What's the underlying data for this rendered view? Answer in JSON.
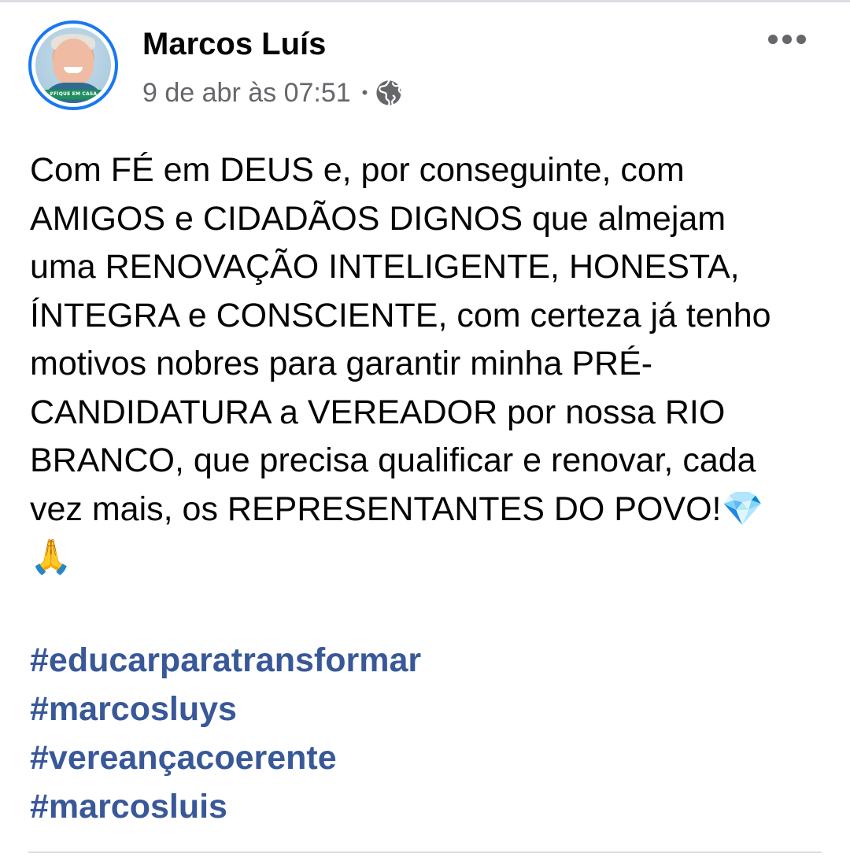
{
  "post": {
    "author": {
      "name": "Marcos Luís",
      "avatar_banner_text": "#FIQUE EM CASA"
    },
    "meta": {
      "timestamp": "9 de abr às 07:51",
      "separator": "•",
      "privacy_icon": "globe-icon"
    },
    "more_icon": "more-options-icon",
    "text_lines": [
      "Com FÉ em DEUS e, por conseguinte, com",
      "AMIGOS e CIDADÃOS DIGNOS que almejam",
      "uma RENOVAÇÃO INTELIGENTE, HONESTA,",
      "ÍNTEGRA e CONSCIENTE, com certeza já tenho",
      "motivos nobres para garantir minha PRÉ-",
      "CANDIDATURA a VEREADOR por nossa RIO",
      "BRANCO, que precisa qualificar e renovar, cada",
      "vez mais, os REPRESENTANTES DO POVO!"
    ],
    "emoji_gem": "💎",
    "emoji_pray": "🙏",
    "hashtags": [
      "#educarparatransformar",
      "#marcosluys",
      "#vereançacoerente",
      "#marcosluis"
    ]
  },
  "colors": {
    "accent": "#1877f2",
    "hashtag": "#385898",
    "meta_text": "#65676b",
    "text": "#050505"
  }
}
